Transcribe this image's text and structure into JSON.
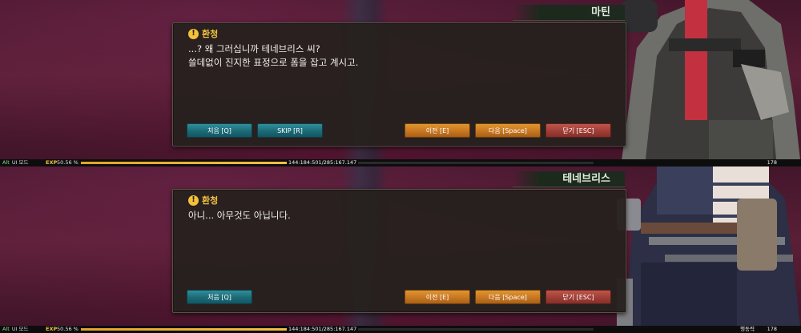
{
  "frames": [
    {
      "speaker_name": "마틴",
      "dialog": {
        "speaker_label": "환청",
        "lines": [
          "...? 왜 그러십니까 테네브리스 씨?",
          "쓸데없이 진지한 표정으로 폼을 잡고 계시고."
        ],
        "buttons": {
          "first": "처음 [Q]",
          "skip": "SKIP [R]",
          "prev": "이전 [E]",
          "next": "다음 [Space]",
          "close": "닫기 [ESC]"
        }
      },
      "status": {
        "alt": "Alt",
        "mode": "UI 모드",
        "exp_label": "EXP",
        "exp_percent": "50.56 %",
        "exp_fraction": 0.5056,
        "coords": "144:184:501/285:167.147",
        "fatigue": "",
        "level": "178"
      }
    },
    {
      "speaker_name": "테네브리스",
      "dialog": {
        "speaker_label": "환청",
        "lines": [
          "아니... 아무것도 아닙니다."
        ],
        "buttons": {
          "first": "처음 [Q]",
          "prev": "이전 [E]",
          "next": "다음 [Space]",
          "close": "닫기 [ESC]"
        }
      },
      "status": {
        "alt": "Alt",
        "mode": "UI 모드",
        "exp_label": "EXP",
        "exp_percent": "50.56 %",
        "exp_fraction": 0.5056,
        "coords": "144:184:501/285:167.147",
        "fatigue": "행동력",
        "level": "178"
      }
    }
  ],
  "colors": {
    "speaker_label": "#f0c040",
    "button_teal": "#1c6a76",
    "button_orange": "#c87722",
    "button_red": "#9e3e36",
    "exp_fill": "#f7c44a"
  },
  "icons": {
    "speaker_icon": "warning-circle-icon"
  }
}
